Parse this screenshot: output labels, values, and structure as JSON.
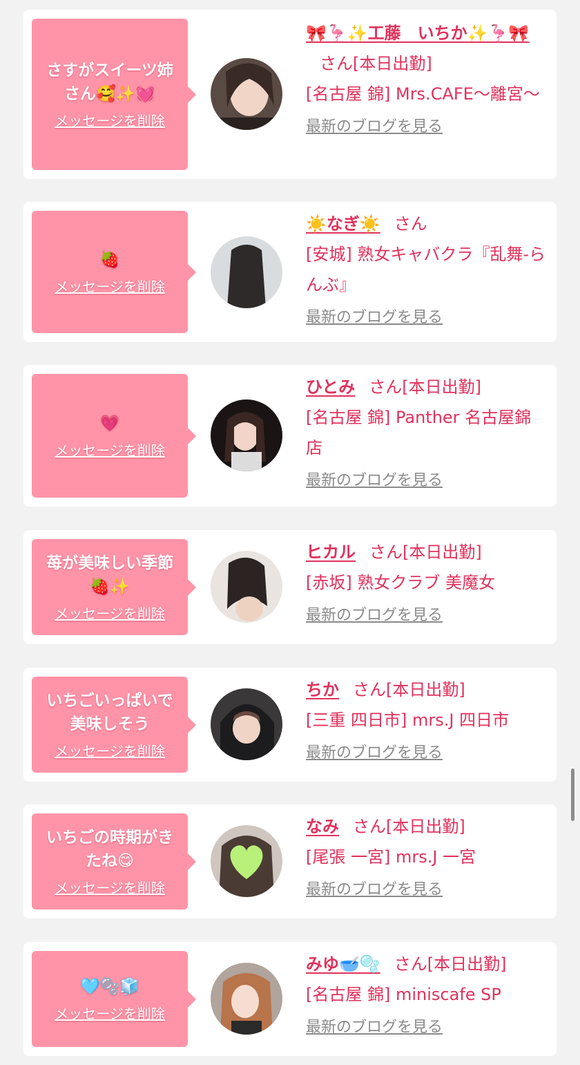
{
  "colors": {
    "background": "#f2f2f2",
    "bubble": "#ff94a8",
    "accent_text": "#e0325c",
    "link_gray": "#8a8a8a"
  },
  "delete_label": "メッセージを削除",
  "blog_label": "最新のブログを見る",
  "entries": [
    {
      "message": "さすがスイーツ姉さん🥰✨💓",
      "name": "🎀🦩✨工藤　いちか✨🦩🎀",
      "suffix": "さん[本日出勤]",
      "shop": "[名古屋 錦] Mrs.CAFE～離宮～"
    },
    {
      "message": "🍓",
      "name": "☀️なぎ☀️",
      "suffix": "さん",
      "shop": "[安城] 熟女キャバクラ『乱舞-らんぶ』"
    },
    {
      "message": "💗",
      "name": "ひとみ",
      "suffix": "さん[本日出勤]",
      "shop": "[名古屋 錦] Panther 名古屋錦店"
    },
    {
      "message": "苺が美味しい季節🍓✨",
      "name": "ヒカル",
      "suffix": "さん[本日出勤]",
      "shop": "[赤坂] 熟女クラブ 美魔女"
    },
    {
      "message": "いちごいっぱいで美味しそう",
      "name": "ちか",
      "suffix": "さん[本日出勤]",
      "shop": "[三重 四日市] mrs.J 四日市"
    },
    {
      "message": "いちごの時期がきたね😋",
      "name": "なみ",
      "suffix": "さん[本日出勤]",
      "shop": "[尾張 一宮] mrs.J 一宮"
    },
    {
      "message": "🩵🫧🧊",
      "name": "みゆ🥣🫧",
      "suffix": "さん[本日出勤]",
      "shop": "[名古屋 錦] miniscafe SP"
    }
  ]
}
